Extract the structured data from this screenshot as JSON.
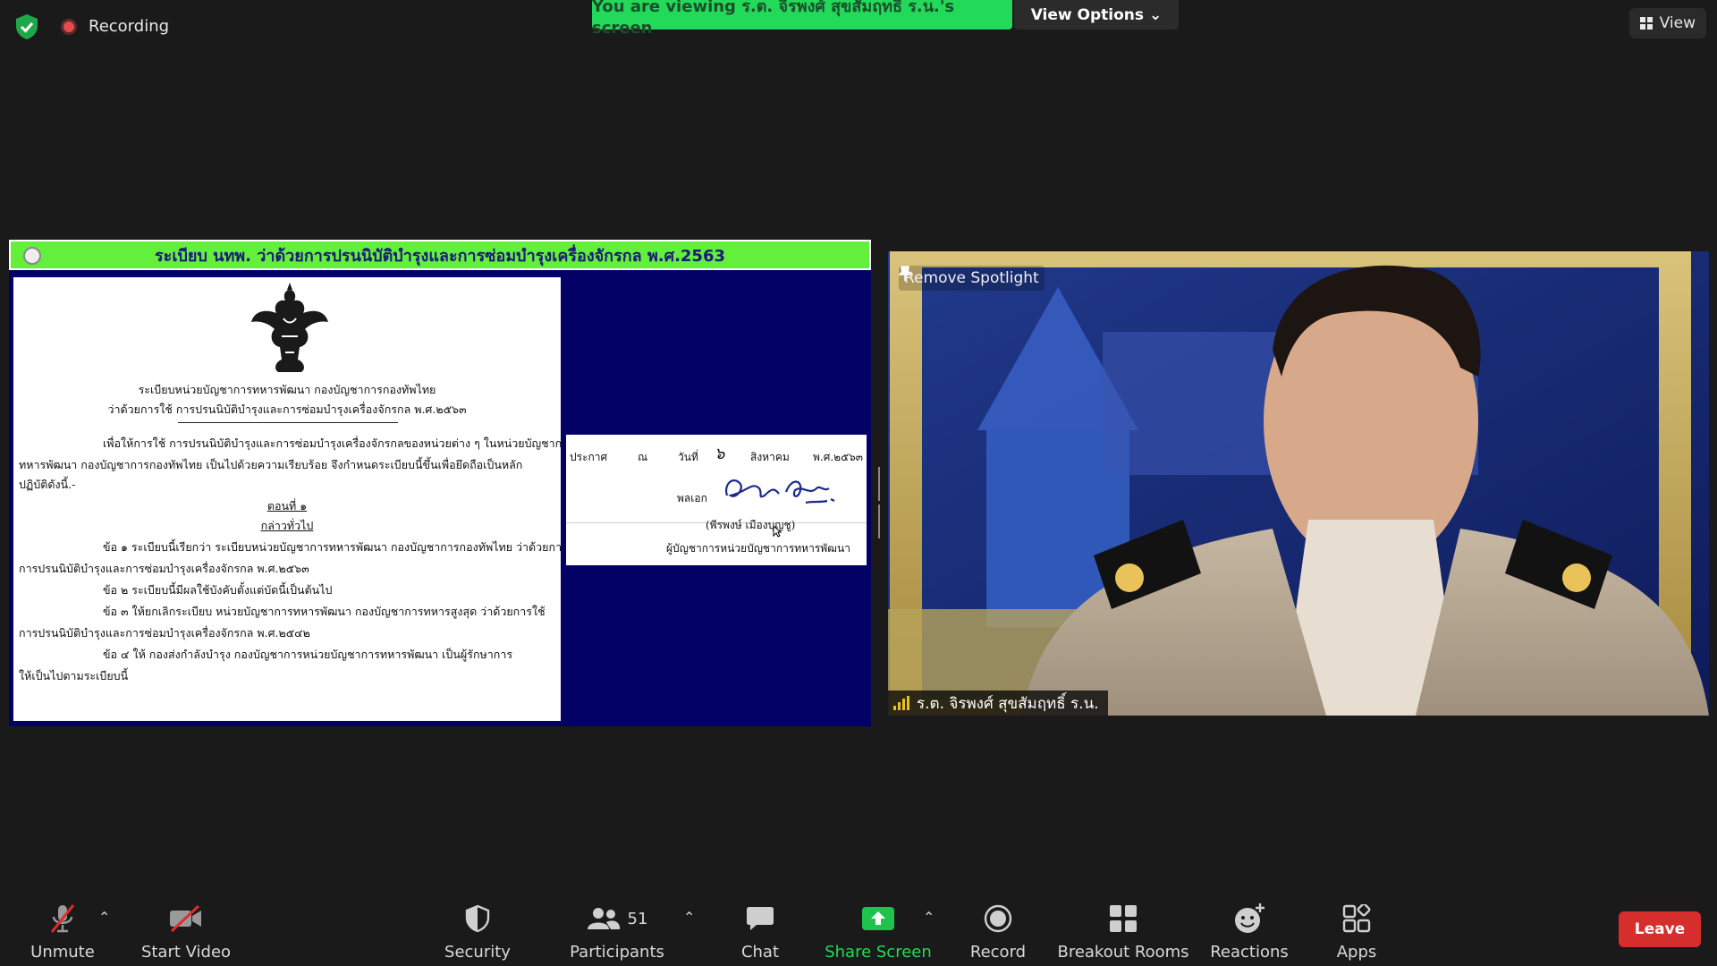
{
  "top": {
    "recording_label": "Recording",
    "viewing_banner": "You are viewing ร.ต. จิรพงศ์ สุขสัมฤทธิ์ ร.น.'s screen",
    "view_options_label": "View Options",
    "view_label": "View"
  },
  "share": {
    "header_title": "ระเบียบ นทพ. ว่าด้วยการปรนนิบัติบำรุงและการซ่อมบำรุงเครื่องจักรกล พ.ศ.2563",
    "doc": {
      "title_line1": "ระเบียบหน่วยบัญชาการทหารพัฒนา กองบัญชาการกองทัพไทย",
      "title_line2": "ว่าด้วยการใช้ การปรนนิบัติบำรุงและการซ่อมบำรุงเครื่องจักรกล พ.ศ.๒๕๖๓",
      "para1_line1": "เพื่อให้การใช้ การปรนนิบัติบำรุงและการซ่อมบำรุงเครื่องจักรกลของหน่วยต่าง ๆ ในหน่วยบัญชาการ",
      "para1_line2": "ทหารพัฒนา กองบัญชาการกองทัพไทย เป็นไปด้วยความเรียบร้อย จึงกำหนดระเบียบนี้ขึ้นเพื่อยึดถือเป็นหลัก",
      "para1_line3": "ปฏิบัติดังนี้.-",
      "section_title": "ตอนที่ ๑",
      "section_subtitle": "กล่าวทั่วไป",
      "clause1_line1": "ข้อ ๑  ระเบียบนี้เรียกว่า ระเบียบหน่วยบัญชาการทหารพัฒนา กองบัญชาการกองทัพไทย ว่าด้วยการใช้",
      "clause1_line2": "การปรนนิบัติบำรุงและการซ่อมบำรุงเครื่องจักรกล พ.ศ.๒๕๖๓",
      "clause2": "ข้อ ๒  ระเบียบนี้มีผลใช้บังคับตั้งแต่บัดนี้เป็นต้นไป",
      "clause3_line1": "ข้อ ๓  ให้ยกเลิกระเบียบ หน่วยบัญชาการทหารพัฒนา กองบัญชาการทหารสูงสุด ว่าด้วยการใช้",
      "clause3_line2": "การปรนนิบัติบำรุงและการซ่อมบำรุงเครื่องจักรกล พ.ศ.๒๕๔๒",
      "clause4_line1": "ข้อ ๔  ให้ กองส่งกำลังบำรุง กองบัญชาการหน่วยบัญชาการทหารพัฒนา เป็นผู้รักษาการ",
      "clause4_line2": "ให้เป็นไปตามระเบียบนี้"
    },
    "sign": {
      "announce": "ประกาศ",
      "at": "ณ",
      "date_label": "วันที่",
      "day": "๖",
      "month": "สิงหาคม",
      "year": "พ.ศ.๒๕๖๓",
      "rank": "พลเอก",
      "name": "(พีรพงษ์  เมืองบุญชู)",
      "position": "ผู้บัญชาการหน่วยบัญชาการทหารพัฒนา"
    }
  },
  "video": {
    "spotlight_label": "Remove Spotlight",
    "participant_name": "ร.ต. จิรพงศ์ สุขสัมฤทธิ์ ร.น."
  },
  "toolbar": {
    "unmute": "Unmute",
    "start_video": "Start Video",
    "security": "Security",
    "participants": "Participants",
    "participant_count": "51",
    "chat": "Chat",
    "share_screen": "Share Screen",
    "record": "Record",
    "breakout_rooms": "Breakout Rooms",
    "reactions": "Reactions",
    "apps": "Apps",
    "leave": "Leave"
  },
  "colors": {
    "banner_green": "#23d959",
    "share_green": "#00c853",
    "leave_red": "#d62d2d",
    "slide_navy": "#040166"
  }
}
